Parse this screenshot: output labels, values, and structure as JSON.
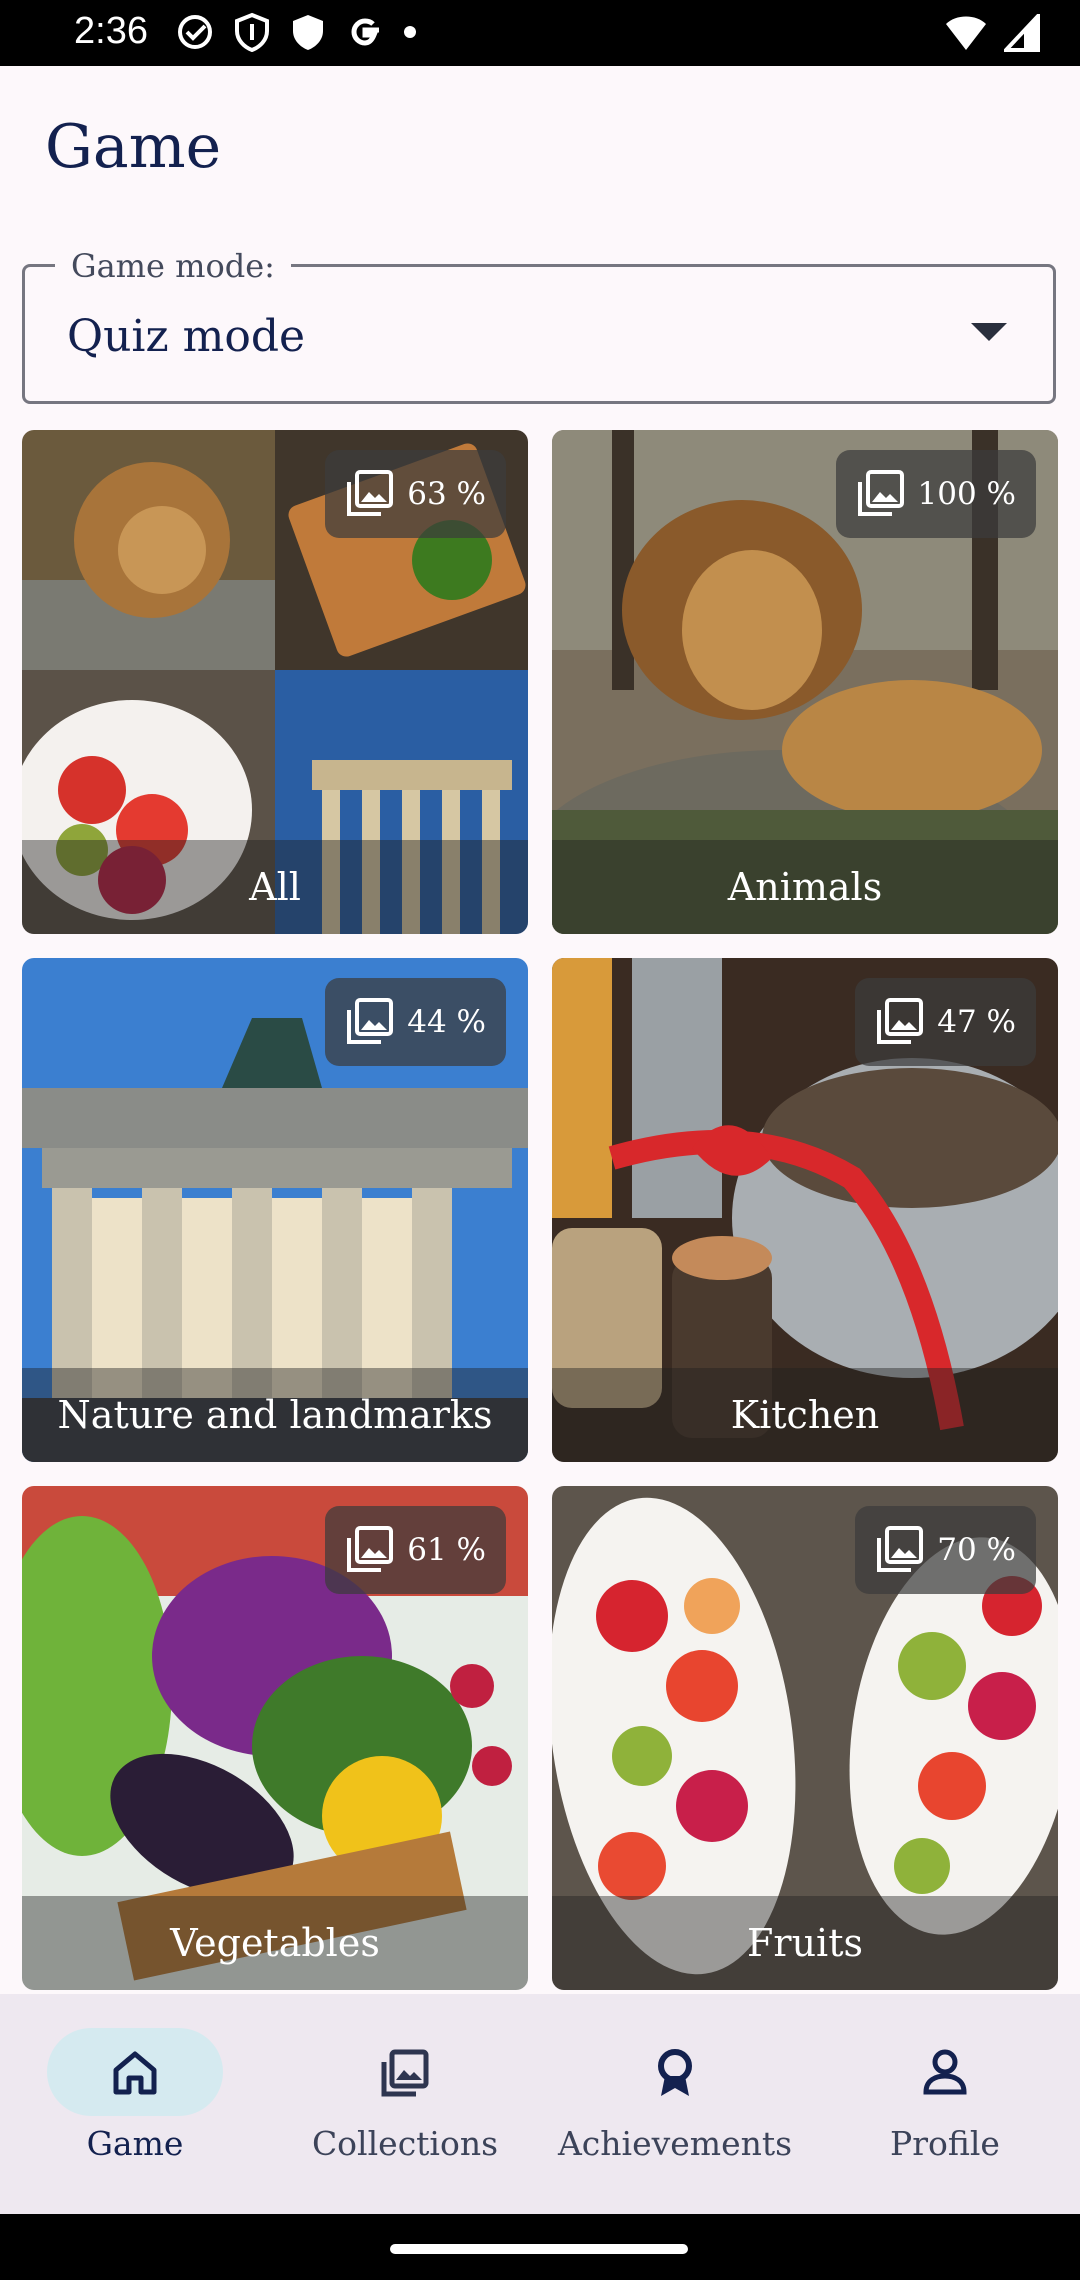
{
  "status_bar": {
    "time": "2:36",
    "icons": [
      "check-circle-icon",
      "shield-icon",
      "shield-filled-icon",
      "google-icon",
      "dot-icon",
      "wifi-icon",
      "signal-icon"
    ]
  },
  "page": {
    "title": "Game"
  },
  "game_mode": {
    "label": "Game mode:",
    "value": "Quiz mode"
  },
  "collections": [
    {
      "label": "All",
      "percent": "63 %"
    },
    {
      "label": "Animals",
      "percent": "100 %"
    },
    {
      "label": "Nature and landmarks",
      "percent": "44 %"
    },
    {
      "label": "Kitchen",
      "percent": "47 %"
    },
    {
      "label": "Vegetables",
      "percent": "61 %"
    },
    {
      "label": "Fruits",
      "percent": "70 %"
    }
  ],
  "bottom_nav": {
    "items": [
      {
        "label": "Game",
        "icon": "home-icon",
        "active": true
      },
      {
        "label": "Collections",
        "icon": "collections-icon",
        "active": false
      },
      {
        "label": "Achievements",
        "icon": "award-icon",
        "active": false
      },
      {
        "label": "Profile",
        "icon": "person-icon",
        "active": false
      }
    ]
  },
  "colors": {
    "accent_text": "#13214f",
    "active_nav_pill": "#d5eaf0",
    "background": "#fdf8fb",
    "nav_background": "#eee8f0"
  }
}
